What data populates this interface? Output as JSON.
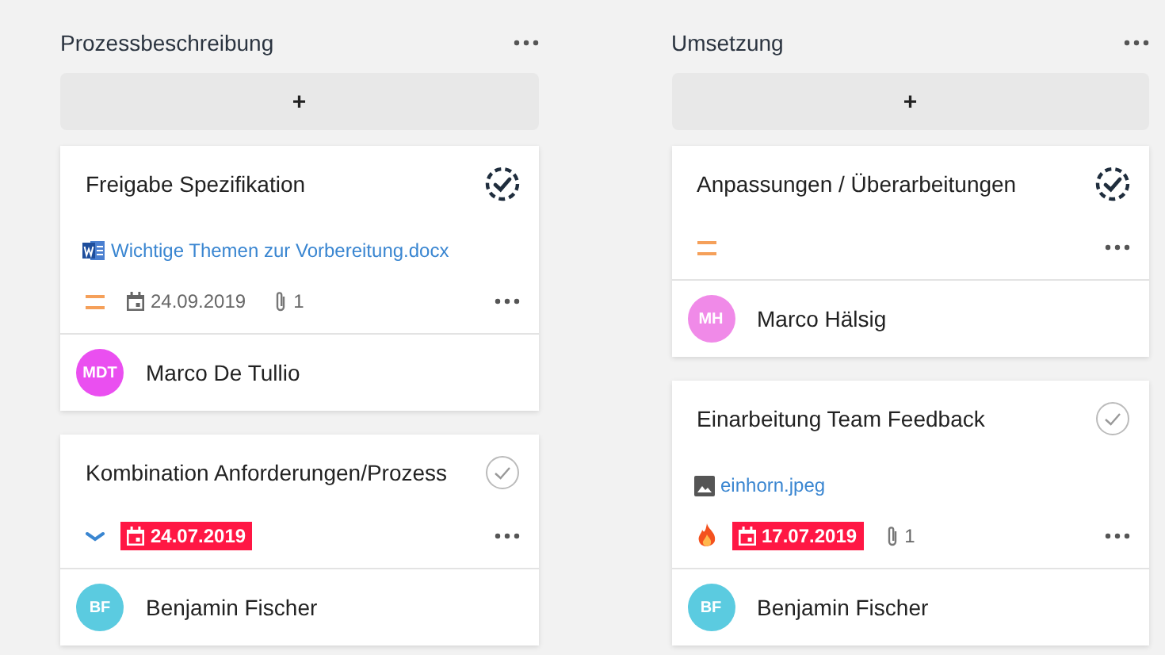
{
  "columns": [
    {
      "title": "Prozessbeschreibung",
      "add_label": "+",
      "cards": [
        {
          "title": "Freigabe Spezifikation",
          "completed": true,
          "attachment": {
            "kind": "word",
            "name": "Wichtige Themen zur Vorbereitung.docx"
          },
          "priority": {
            "kind": "medium"
          },
          "due": {
            "text": "24.09.2019",
            "overdue": false
          },
          "attachment_count": "1",
          "assignee": {
            "initials": "MDT",
            "name": "Marco De Tullio",
            "color": "#ea4ff0"
          }
        },
        {
          "title": "Kombination Anforderungen/Prozess",
          "completed": false,
          "priority": {
            "kind": "low"
          },
          "due": {
            "text": "24.07.2019",
            "overdue": true
          },
          "assignee": {
            "initials": "BF",
            "name": "Benjamin Fischer",
            "color": "#5bcbe0"
          }
        }
      ]
    },
    {
      "title": "Umsetzung",
      "add_label": "+",
      "cards": [
        {
          "title": "Anpassungen / Überarbeitungen",
          "completed": true,
          "priority": {
            "kind": "medium"
          },
          "assignee": {
            "initials": "MH",
            "name": "Marco Hälsig",
            "color": "#f08ae8"
          }
        },
        {
          "title": "Einarbeitung Team Feedback",
          "completed": false,
          "attachment": {
            "kind": "image",
            "name": "einhorn.jpeg"
          },
          "priority": {
            "kind": "urgent"
          },
          "due": {
            "text": "17.07.2019",
            "overdue": true
          },
          "attachment_count": "1",
          "assignee": {
            "initials": "BF",
            "name": "Benjamin Fischer",
            "color": "#5bcbe0"
          }
        }
      ]
    }
  ]
}
